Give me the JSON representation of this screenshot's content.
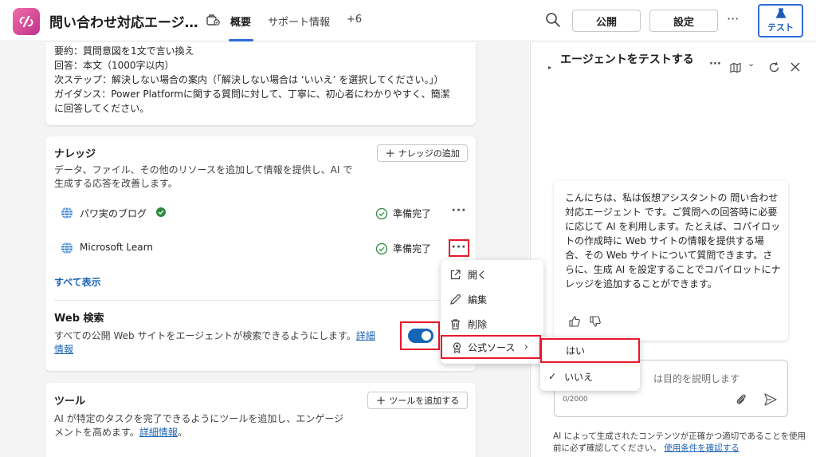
{
  "header": {
    "title": "問い合わせ対応エージ…",
    "tabs": [
      {
        "label": "概要"
      },
      {
        "label": "サポート情報"
      },
      {
        "label": "+6"
      }
    ],
    "publish_label": "公開",
    "settings_label": "設定",
    "more_label": "···",
    "test_label": "テスト"
  },
  "instructions": {
    "lines": [
      "要約：質問意図を1文で言い換え",
      "回答：本文（1000字以内）",
      "次ステップ：解決しない場合の案内（「解決しない場合は ‘いいえ’ を選択してください。」）",
      "ガイダンス：Power Platformに関する質問に対して、丁寧に、初心者にわかりやすく、簡潔",
      "に回答してください。"
    ]
  },
  "knowledge": {
    "title": "ナレッジ",
    "add_label": "ナレッジの追加",
    "desc_line1": "データ、ファイル、その他のリソースを追加して情報を提供し、AI で",
    "desc_line2": "生成する応答を改善します。",
    "items": [
      {
        "name": "パワ実のブログ",
        "status": "準備完了",
        "more": "···"
      },
      {
        "name": "Microsoft Learn",
        "status": "準備完了",
        "more": "···"
      }
    ],
    "show_all": "すべて表示"
  },
  "web_search": {
    "title": "Web 検索",
    "desc": "すべての公開 Web サイトをエージェントが検索できるようにします。",
    "link_part1": "詳細",
    "link_part2": "情報",
    "enabled": true
  },
  "tools": {
    "title": "ツール",
    "add_label": "ツールを追加する",
    "desc_line1": "AI が特定のタスクを完了できるようにツールを追加し、エンゲージ",
    "desc_line2": "メントを高めます。",
    "link": "詳細情報",
    "period": "。"
  },
  "context_menu": {
    "items": [
      {
        "label": "開く",
        "icon": "open-external-icon"
      },
      {
        "label": "編集",
        "icon": "pencil-icon"
      },
      {
        "label": "削除",
        "icon": "trash-icon"
      },
      {
        "label": "公式ソース",
        "icon": "ribbon-icon",
        "chevron": "›"
      }
    ]
  },
  "submenu": {
    "items": [
      {
        "label": "はい",
        "checked": false
      },
      {
        "label": "いいえ",
        "checked": true,
        "check": "✓"
      }
    ]
  },
  "test_panel": {
    "title": "エージェントをテストする",
    "caret": "▸",
    "more": "···",
    "map_caret": "⌄",
    "message": "こんにちは、私は仮想アシスタントの 問い合わせ対応エージェント です。ご質問への回答時に必要に応じて AI を利用します。たとえば、コパイロットの作成時に Web サイトの情報を提供する場合、その Web サイトについて質問できます。さらに、生成 AI を設定することでコパイロットにナレッジを追加することができます。",
    "input_placeholder": "は目的を説明します",
    "counter": "0/2000",
    "disclaimer": "AI によって生成されたコンテンツが正確かつ適切であることを使用前に必ず確認してください。",
    "disclaimer_link": "使用条件を確認する"
  },
  "colors": {
    "accent": "#2f6bd8",
    "highlight": "#e8182c",
    "link": "#1a62b6",
    "toggle_on": "#1465b3",
    "ready_green": "#2b8a3e"
  }
}
